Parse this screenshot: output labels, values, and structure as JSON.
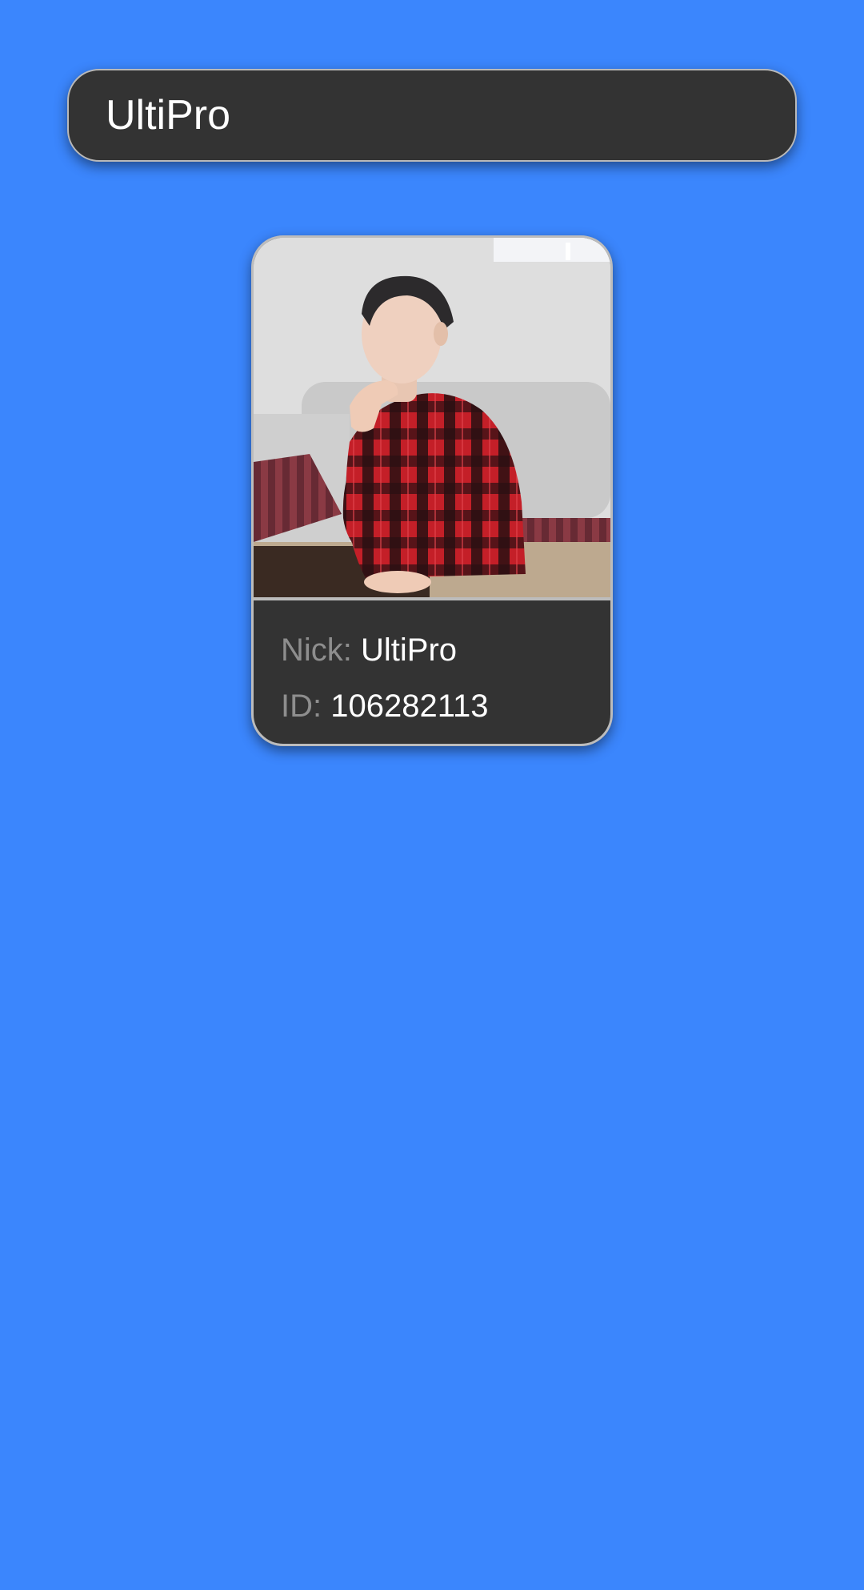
{
  "search": {
    "query": "UltiPro"
  },
  "profile": {
    "photo_icon": "user-photo",
    "nick_label": "Nick:",
    "nick_value": "UltiPro",
    "id_label": "ID:",
    "id_value": "106282113"
  },
  "colors": {
    "background": "#3b86fd",
    "card": "#333333",
    "border": "#bcbcbc",
    "label": "#8e8e8e",
    "value": "#ffffff"
  }
}
